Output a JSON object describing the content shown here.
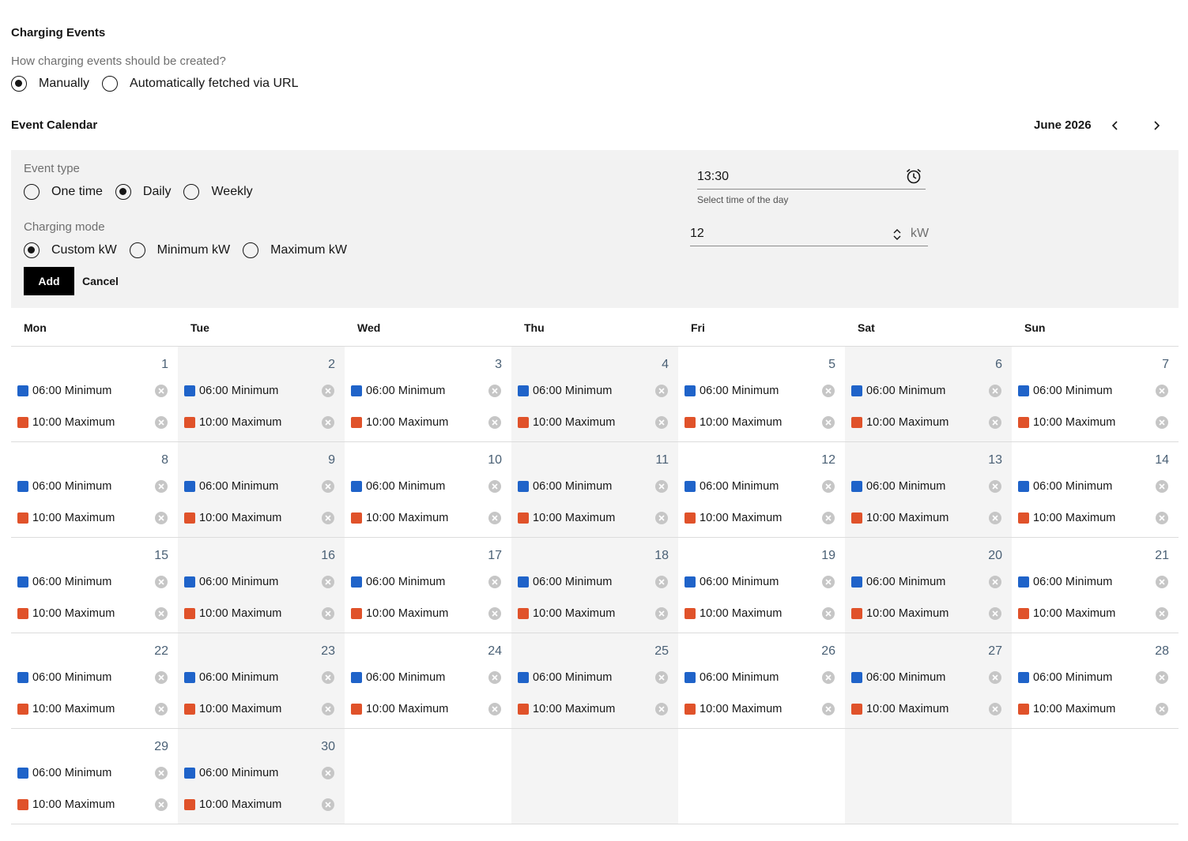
{
  "header": {
    "title": "Charging Events",
    "question": "How charging events should be created?",
    "creation_options": [
      {
        "label": "Manually",
        "checked": true
      },
      {
        "label": "Automatically fetched via URL",
        "checked": false
      }
    ]
  },
  "calendar": {
    "title": "Event Calendar",
    "month_label": "June 2026",
    "prev_icon": "chevron-left-icon",
    "next_icon": "chevron-right-icon",
    "weekdays": [
      "Mon",
      "Tue",
      "Wed",
      "Thu",
      "Fri",
      "Sat",
      "Sun"
    ],
    "weeks": [
      [
        1,
        2,
        3,
        4,
        5,
        6,
        7
      ],
      [
        8,
        9,
        10,
        11,
        12,
        13,
        14
      ],
      [
        15,
        16,
        17,
        18,
        19,
        20,
        21
      ],
      [
        22,
        23,
        24,
        25,
        26,
        27,
        28
      ],
      [
        29,
        30,
        null,
        null,
        null,
        null,
        null
      ]
    ],
    "events": [
      {
        "label": "06:00 Minimum",
        "color": "#1f63c9"
      },
      {
        "label": "10:00 Maximum",
        "color": "#e0522a"
      }
    ],
    "remove_icon": "close-circle-icon"
  },
  "form": {
    "event_type_label": "Event type",
    "event_types": [
      {
        "label": "One time",
        "checked": false
      },
      {
        "label": "Daily",
        "checked": true
      },
      {
        "label": "Weekly",
        "checked": false
      }
    ],
    "charging_mode_label": "Charging mode",
    "charging_modes": [
      {
        "label": "Custom kW",
        "checked": true
      },
      {
        "label": "Minimum kW",
        "checked": false
      },
      {
        "label": "Maximum kW",
        "checked": false
      }
    ],
    "time_value": "13:30",
    "time_helper": "Select time of the day",
    "time_icon": "alarm-clock-icon",
    "kw_value": "12",
    "kw_unit": "kW",
    "add_label": "Add",
    "cancel_label": "Cancel"
  }
}
